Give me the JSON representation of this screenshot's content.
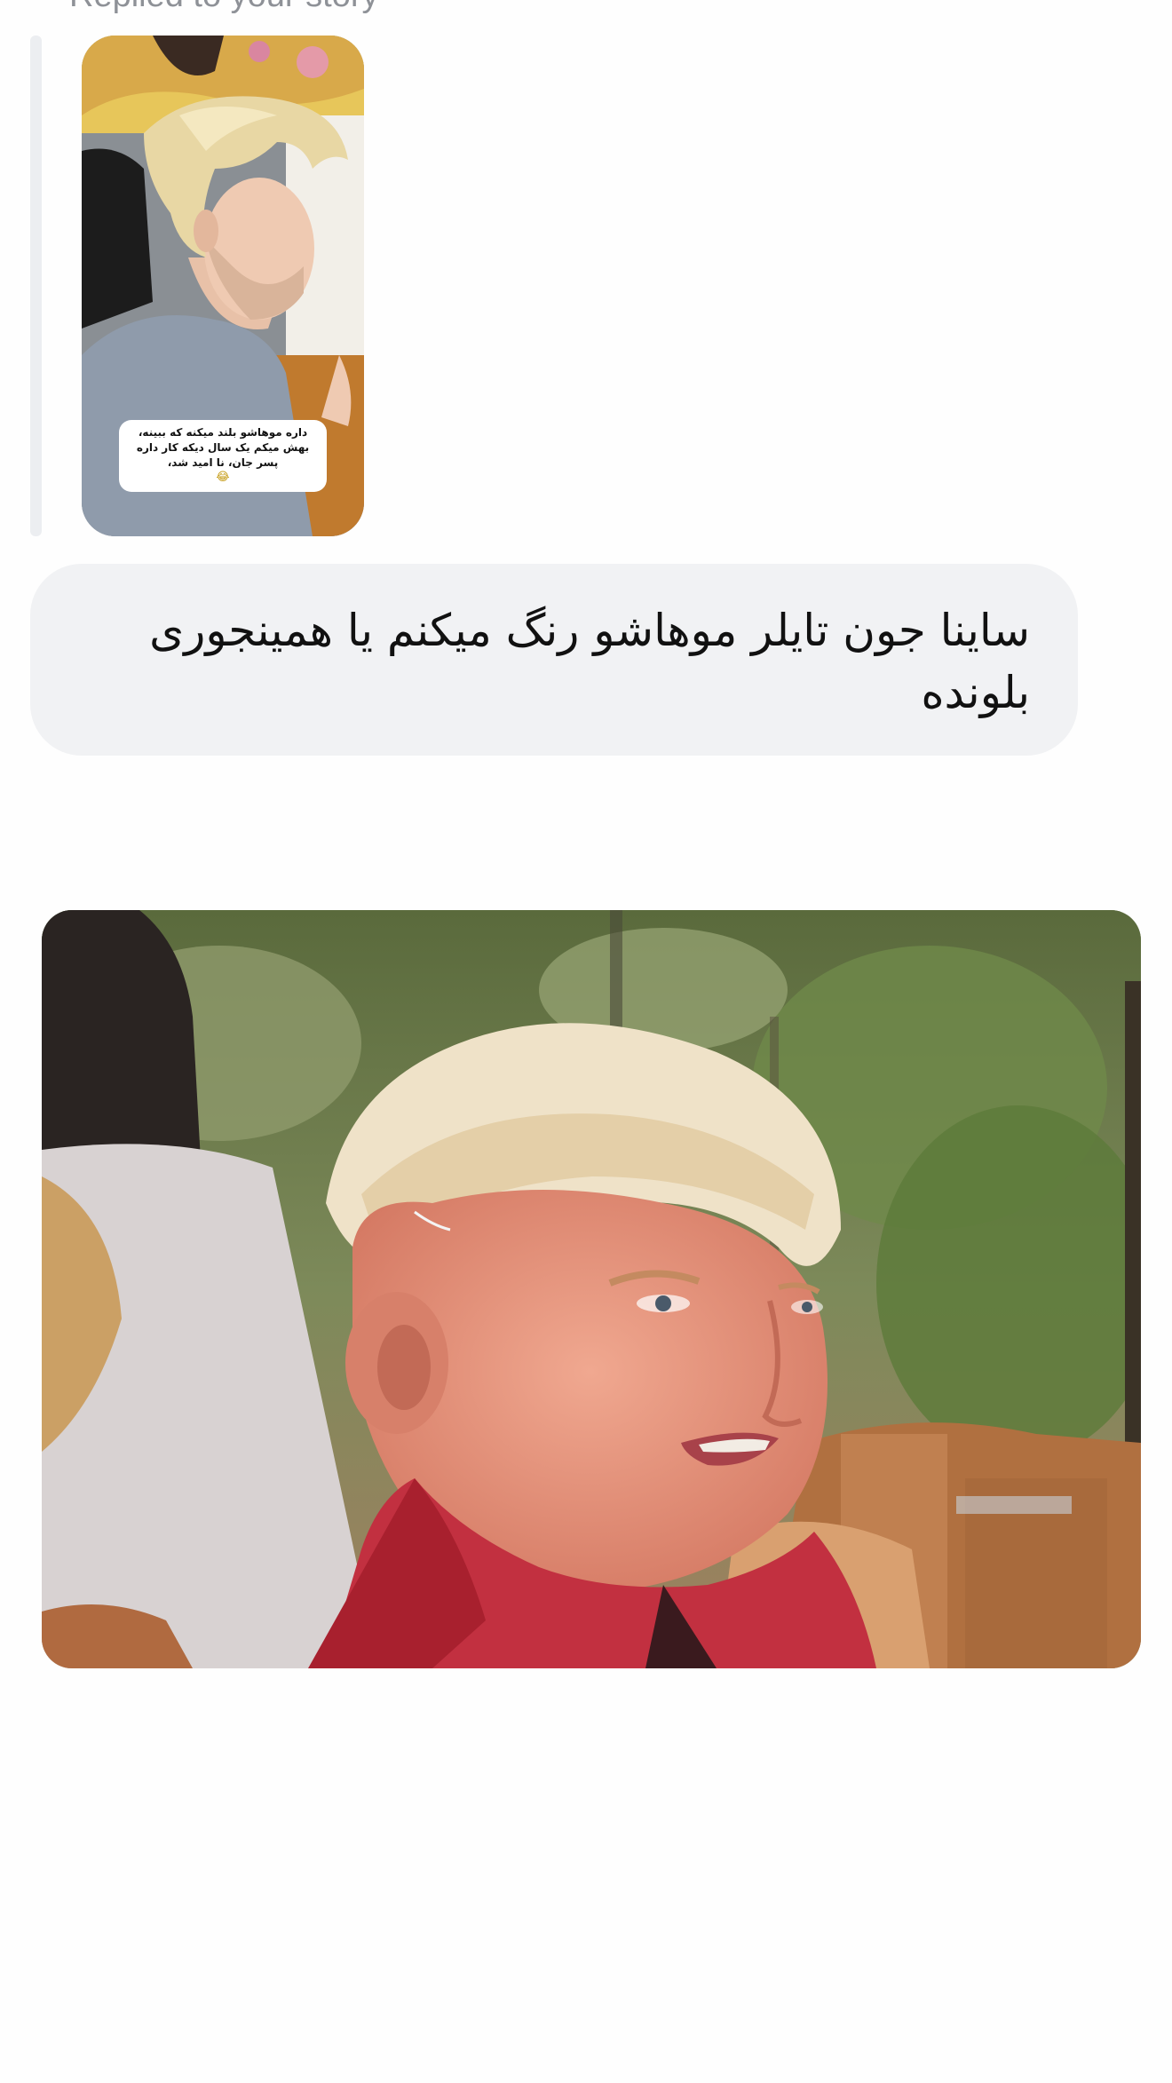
{
  "thread": {
    "reply_context": {
      "label": "Replied to your story",
      "story_caption": {
        "line1": "داره موهاشو بلند میکنه که ببینه،",
        "line2": "بهش میکم یک سال دیکه کار داره",
        "line3": "پسر جان، نا امید شد،",
        "emoji": "😂"
      }
    },
    "message": {
      "line1": "ساینا جون تایلر موهاشو رنگ میکنم یا همینجوری",
      "line2": "بلونده"
    }
  },
  "colors": {
    "bubble_background": "#f1f2f4",
    "reply_bar": "#eceef1",
    "secondary_text": "#8e9197",
    "primary_text": "#111111"
  }
}
